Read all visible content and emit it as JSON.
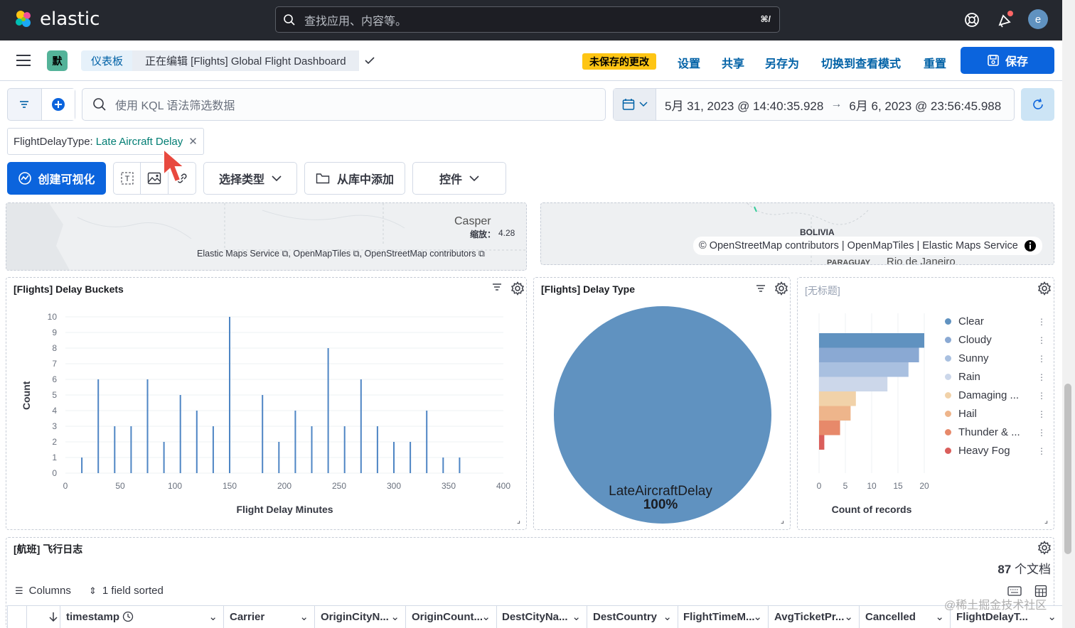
{
  "header": {
    "brand": "elastic",
    "search_placeholder": "查找应用、内容等。",
    "search_kbd": "⌘/",
    "avatar_initial": "e"
  },
  "subheader": {
    "space_badge": "默",
    "breadcrumb_root": "仪表板",
    "breadcrumb_current": "正在编辑 [Flights] Global Flight Dashboard",
    "unsaved_badge": "未保存的更改",
    "links": [
      "设置",
      "共享",
      "另存为",
      "切换到查看模式",
      "重置"
    ],
    "save_label": "保存"
  },
  "query": {
    "kql_placeholder": "使用 KQL 语法筛选数据",
    "date_start": "5月 31, 2023 @ 14:40:35.928",
    "date_arrow": "→",
    "date_end": "6月 6, 2023 @ 23:56:45.988"
  },
  "filter_pill": {
    "field": "FlightDelayType:",
    "value": "Late Aircraft Delay"
  },
  "toolbar": {
    "create_label": "创建可视化",
    "select_type": "选择类型",
    "add_from_library": "从库中添加",
    "controls": "控件"
  },
  "map_left": {
    "place": "Casper",
    "zoom_label": "缩放：",
    "zoom_value": "4.28",
    "attribution": "Elastic Maps Service ⧉, OpenMapTiles ⧉, OpenStreetMap contributors ⧉"
  },
  "map_right": {
    "place1": "BOLIVIA",
    "place2": "Rio de Janeiro",
    "place3": "PARAGUAY",
    "attribution": "© OpenStreetMap contributors | OpenMapTiles | Elastic Maps Service"
  },
  "delay_buckets": {
    "title": "[Flights] Delay Buckets",
    "ylabel": "Count",
    "xlabel": "Flight Delay Minutes"
  },
  "delay_type": {
    "title": "[Flights] Delay Type",
    "slice_label": "LateAircraftDelay",
    "slice_pct": "100%"
  },
  "weather": {
    "title": "[无标题]",
    "xlabel": "Count of records",
    "legend": [
      "Clear",
      "Cloudy",
      "Sunny",
      "Rain",
      "Damaging ...",
      "Hail",
      "Thunder & ...",
      "Heavy Fog"
    ],
    "colors": [
      "#6092c0",
      "#8aa9d3",
      "#a9c0e0",
      "#ccd7ea",
      "#f1d2a9",
      "#eeb58b",
      "#e7896a",
      "#da5e5b"
    ]
  },
  "flight_log": {
    "title": "[航班] 飞行日志",
    "doc_count": "87",
    "doc_unit": "个文档",
    "columns_label": "Columns",
    "sorted_label": "1 field sorted",
    "headers": [
      "timestamp",
      "Carrier",
      "OriginCityN...",
      "OriginCount...",
      "DestCityNa...",
      "DestCountry",
      "FlightTimeM...",
      "AvgTicketPr...",
      "Cancelled",
      "FlightDelayT..."
    ]
  },
  "watermark": "@稀土掘金技术社区",
  "chart_data": [
    {
      "type": "bar",
      "title": "[Flights] Delay Buckets",
      "xlabel": "Flight Delay Minutes",
      "ylabel": "Count",
      "xlim": [
        0,
        400
      ],
      "ylim": [
        0,
        10
      ],
      "xticks": [
        0,
        50,
        100,
        150,
        200,
        250,
        300,
        350,
        400
      ],
      "yticks": [
        0,
        1,
        2,
        3,
        4,
        5,
        6,
        7,
        8,
        9,
        10
      ],
      "x": [
        15,
        30,
        45,
        60,
        75,
        90,
        105,
        120,
        135,
        150,
        180,
        195,
        210,
        225,
        240,
        255,
        270,
        285,
        300,
        315,
        330,
        345,
        360
      ],
      "values": [
        1,
        6,
        3,
        3,
        6,
        2,
        5,
        4,
        3,
        10,
        5,
        2,
        4,
        3,
        8,
        3,
        6,
        3,
        2,
        2,
        4,
        1,
        1
      ]
    },
    {
      "type": "pie",
      "title": "[Flights] Delay Type",
      "categories": [
        "LateAircraftDelay"
      ],
      "values": [
        100
      ]
    },
    {
      "type": "bar",
      "orientation": "horizontal",
      "title": "[无标题]",
      "xlabel": "Count of records",
      "xlim": [
        0,
        20
      ],
      "xticks": [
        0,
        5,
        10,
        15,
        20
      ],
      "categories": [
        "Clear",
        "Cloudy",
        "Sunny",
        "Rain",
        "Damaging ...",
        "Hail",
        "Thunder & ...",
        "Heavy Fog"
      ],
      "values": [
        20,
        19,
        17,
        13,
        7,
        6,
        4,
        1
      ]
    }
  ]
}
